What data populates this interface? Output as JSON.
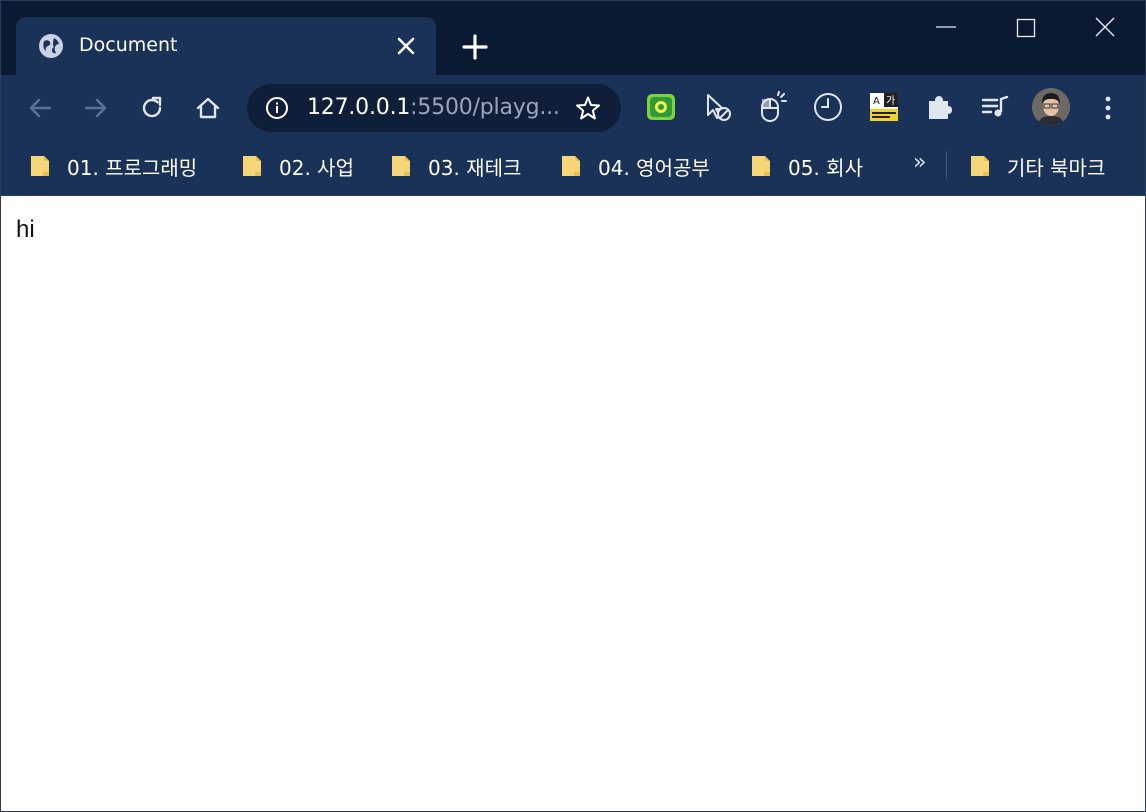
{
  "tab": {
    "title": "Document",
    "favicon": "globe-icon"
  },
  "window_controls": [
    "minimize-icon",
    "maximize-icon",
    "close-icon"
  ],
  "toolbar": {
    "url_host": "127.0.0.1",
    "url_rest": ":5500/playg...",
    "extensions": [
      "screen-capture-extension-icon",
      "cursor-blocker-extension-icon",
      "mouse-extension-icon",
      "clock-extension-icon",
      "dictionary-extension-icon",
      "puzzle-extensions-icon",
      "media-queue-icon"
    ]
  },
  "bookmarks": {
    "items": [
      {
        "label": "01. 프로그래밍"
      },
      {
        "label": "02. 사업"
      },
      {
        "label": "03. 재테크"
      },
      {
        "label": "04. 영어공부"
      },
      {
        "label": "05. 회사"
      }
    ],
    "more": "»",
    "other": "기타 북마크"
  },
  "page": {
    "body_text": "hi"
  },
  "colors": {
    "frame": "#0b1a33",
    "toolbar": "#1a3158",
    "omnibox": "#0f1f3a",
    "folder": "#f5d77a"
  }
}
